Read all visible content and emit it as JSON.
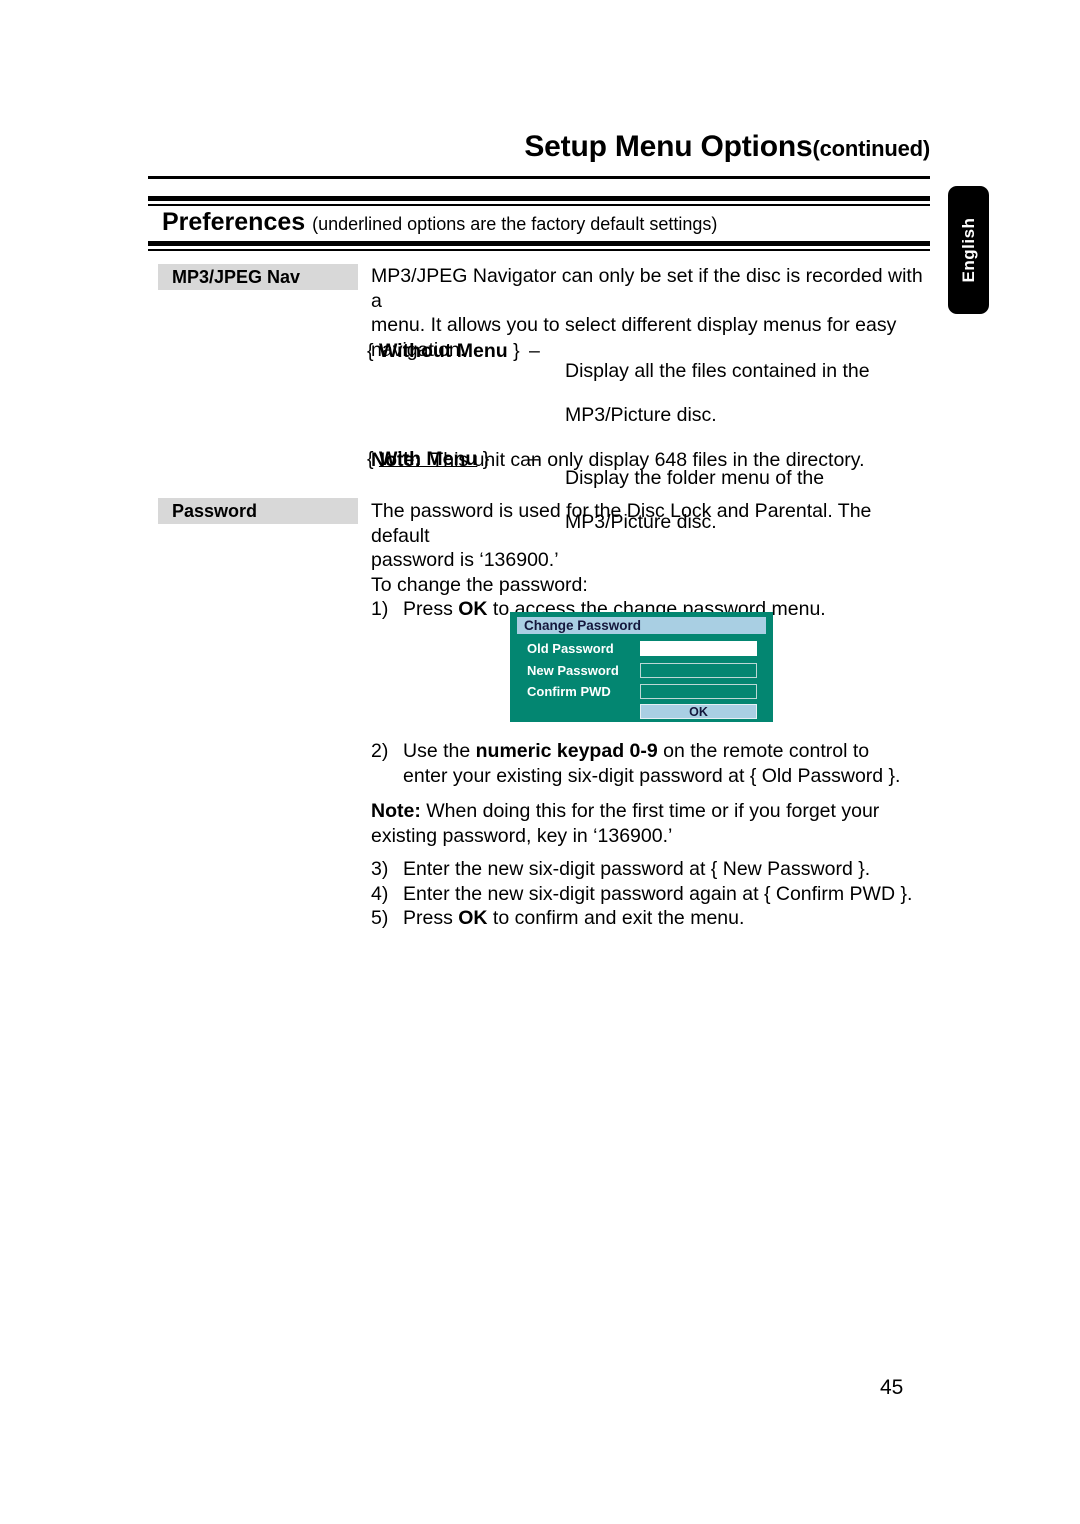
{
  "page": {
    "title_main": "Setup Menu Options",
    "title_continued": "(continued)",
    "section_title": "Preferences",
    "section_subtitle": "(underlined options are the factory default settings)",
    "language_tab": "English",
    "page_number": "45"
  },
  "colors": {
    "label_chip_bg": "#d8d8d8",
    "osd_bg": "#038671",
    "osd_titlebar_bg": "#a9cfe3",
    "osd_button_bg": "#a9cfe3",
    "tab_bg": "#000000",
    "text": "#000000"
  },
  "mp3jpeg": {
    "label": "MP3/JPEG Nav",
    "intro_line1": "MP3/JPEG Navigator can only be set if the disc is recorded with a",
    "intro_line2": "menu.  It allows you to select different display menus for easy",
    "intro_line3": "navigation.",
    "options": [
      {
        "open_brace": "{",
        "name": "Without Menu",
        "close_brace": "}",
        "underlined": false,
        "dash": "–",
        "desc_line1": "Display all the files contained in the",
        "desc_line2": "MP3/Picture disc."
      },
      {
        "open_brace": "{",
        "name": "With Menu",
        "close_brace": "}",
        "underlined": true,
        "dash": "–",
        "desc_line1": "Display the folder menu of the",
        "desc_line2": "MP3/Picture disc."
      }
    ],
    "note_label": "Note:",
    "note_text": "This unit can only display 648 files in the directory."
  },
  "password": {
    "label": "Password",
    "intro_line1": "The password is used for the Disc Lock and Parental. The default",
    "intro_line2": "password is ‘136900.’",
    "intro_line3": "To change the password:",
    "step1_num": "1)",
    "step1_pre": "Press ",
    "step1_bold": "OK",
    "step1_post": " to access the change password menu.",
    "step2_num": "2)",
    "step2_pre": "Use the ",
    "step2_bold": "numeric keypad 0-9",
    "step2_post": " on the remote control to",
    "step2_line2": "enter your existing six-digit password at { Old Password }.",
    "note_label": "Note:",
    "note_line1": " When doing this for the first time or if you forget your",
    "note_line2": "existing password, key in ‘136900.’",
    "step3_num": "3)",
    "step3_text": "Enter the new six-digit password at { New Password }.",
    "step4_num": "4)",
    "step4_text": "Enter the new six-digit password again at { Confirm PWD }.",
    "step5_num": "5)",
    "step5_pre": "Press ",
    "step5_bold": "OK",
    "step5_post": " to confirm and exit the menu."
  },
  "osd_dialog": {
    "title": "Change Password",
    "rows": [
      {
        "label": "Old Password",
        "value": "",
        "focused": true
      },
      {
        "label": "New Password",
        "value": "",
        "focused": false
      },
      {
        "label": "Confirm PWD",
        "value": "",
        "focused": false
      }
    ],
    "ok_label": "OK"
  }
}
